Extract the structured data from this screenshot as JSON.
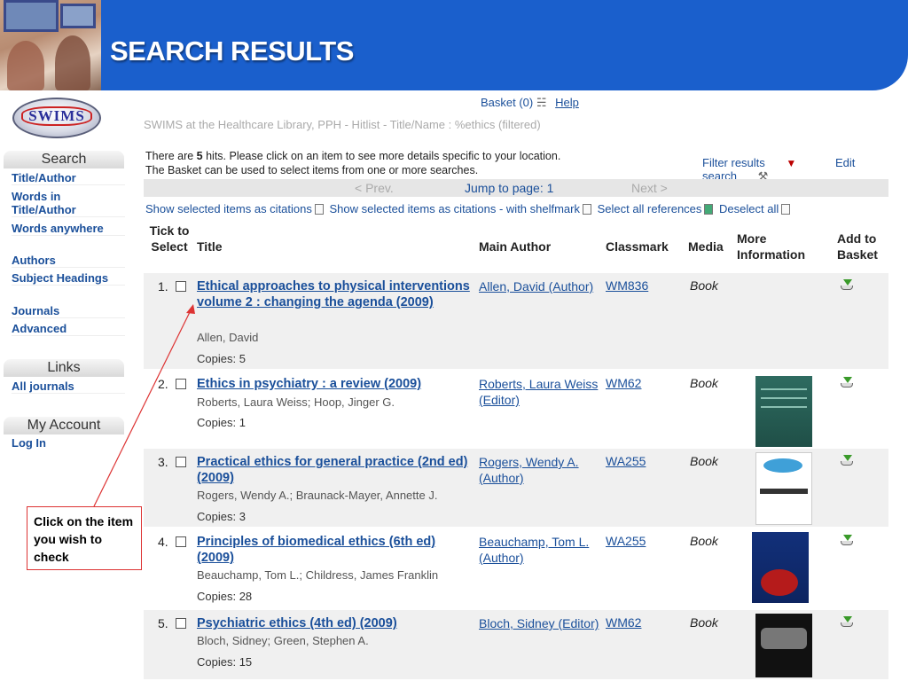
{
  "banner": {
    "title": "SEARCH RESULTS"
  },
  "logo": {
    "text": "SWIMS"
  },
  "sidebar": {
    "search_heading": "Search",
    "search_links": [
      "Title/Author",
      "Words in Title/Author",
      "Words anywhere",
      "Authors",
      "Subject Headings",
      "Journals",
      "Advanced"
    ],
    "links_heading": "Links",
    "links_items": [
      "All journals"
    ],
    "account_heading": "My Account",
    "account_items": [
      "Log In"
    ]
  },
  "top": {
    "basket": "Basket (0)",
    "help": "Help",
    "breadcrumb": "SWIMS at the Healthcare Library, PPH - Hitlist - Title/Name : %ethics (filtered)"
  },
  "info": {
    "hits_pre": "There are ",
    "hits_count": "5",
    "hits_post": " hits. Please click on an item to see more details specific to your location.",
    "basket_note": "The Basket can be used to select items from one or more searches.",
    "filter_results": "Filter results",
    "edit_search": "Edit search"
  },
  "pager": {
    "prev": "< Prev.",
    "jump": "Jump to page: 1",
    "next": "Next >"
  },
  "actions": {
    "citations": "Show selected items as citations",
    "citations_shelfmark": "Show selected items as citations - with shelfmark",
    "select_all": "Select all references",
    "deselect_all": "Deselect all"
  },
  "table": {
    "headers": {
      "tick": "Tick to Select",
      "title": "Title",
      "main_author": "Main Author",
      "classmark": "Classmark",
      "media": "Media",
      "more_info": "More Information",
      "add": "Add to Basket"
    },
    "rows": [
      {
        "num": "1.",
        "title": "Ethical approaches to physical interventions volume 2 : changing the agenda (2009)",
        "authors": "Allen, David",
        "copies": "Copies: 5",
        "main_author": "Allen, David (Author)",
        "classmark": "WM836",
        "media": "Book"
      },
      {
        "num": "2.",
        "title": "Ethics in psychiatry : a review (2009)",
        "authors": "Roberts, Laura Weiss; Hoop, Jinger G.",
        "copies": "Copies: 1",
        "main_author": "Roberts, Laura Weiss (Editor)",
        "classmark": "WM62",
        "media": "Book"
      },
      {
        "num": "3.",
        "title": "Practical ethics for general practice (2nd ed) (2009)",
        "authors": "Rogers, Wendy A.; Braunack-Mayer, Annette J.",
        "copies": "Copies: 3",
        "main_author": "Rogers, Wendy A. (Author)",
        "classmark": "WA255",
        "media": "Book"
      },
      {
        "num": "4.",
        "title": "Principles of biomedical ethics (6th ed) (2009)",
        "authors": "Beauchamp, Tom L.; Childress, James Franklin",
        "copies": "Copies: 28",
        "main_author": "Beauchamp, Tom L. (Author)",
        "classmark": "WA255",
        "media": "Book"
      },
      {
        "num": "5.",
        "title": "Psychiatric ethics (4th ed) (2009)",
        "authors": "Bloch, Sidney; Green, Stephen A.",
        "copies": "Copies: 15",
        "main_author": "Bloch, Sidney (Editor)",
        "classmark": "WM62",
        "media": "Book"
      }
    ]
  },
  "annotation": {
    "text": "Click on the item you wish to check"
  }
}
